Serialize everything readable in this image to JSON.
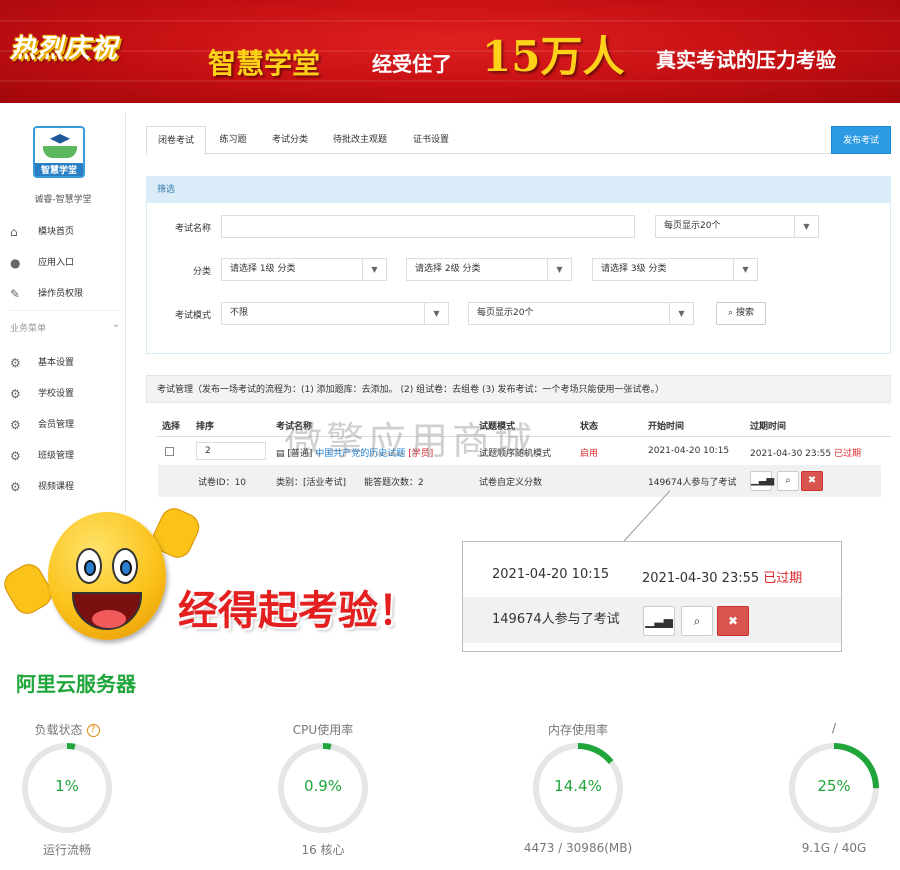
{
  "banner": {
    "celebrate": "热烈庆祝",
    "brand": "智慧学堂",
    "middle": "经受住了",
    "number": "15万人",
    "tail": "真实考试的压力考验"
  },
  "sidebar": {
    "logo_text": "智慧学堂",
    "site_name": "诚睿-智慧学堂",
    "items": [
      {
        "label": "模块首页",
        "icon": "home-icon"
      },
      {
        "label": "应用入口",
        "icon": "chat-icon"
      },
      {
        "label": "操作员权限",
        "icon": "edit-icon"
      }
    ],
    "section": "业务菜单",
    "biz_items": [
      {
        "label": "基本设置",
        "icon": "gear-icon"
      },
      {
        "label": "学校设置",
        "icon": "gear-icon"
      },
      {
        "label": "会员管理",
        "icon": "gear-icon"
      },
      {
        "label": "班级管理",
        "icon": "gear-icon"
      },
      {
        "label": "视频课程",
        "icon": "gear-icon"
      }
    ]
  },
  "tabs": [
    "闭卷考试",
    "练习题",
    "考试分类",
    "待批改主观题",
    "证书设置"
  ],
  "publish_button": "发布考试",
  "filter": {
    "header": "筛选",
    "name_label": "考试名称",
    "per_page_1": "每页显示20个",
    "category_label": "分类",
    "cat1": "请选择 1级 分类",
    "cat2": "请选择 2级 分类",
    "cat3": "请选择 3级 分类",
    "mode_label": "考试模式",
    "mode_value": "不限",
    "per_page_2": "每页显示20个",
    "search_button": "搜索"
  },
  "exam": {
    "header": "考试管理（发布一场考试的流程为：(1) 添加题库：去添加。 (2) 组试卷：去组卷 (3) 发布考试：一个考场只能使用一张试卷。）",
    "columns": [
      "选择",
      "排序",
      "考试名称",
      "试题模式",
      "状态",
      "开始时间",
      "过期时间"
    ],
    "row": {
      "sort": "2",
      "type_tag": "[普通]",
      "name": "中国共产党的历史试题",
      "name_tag": "[学员]",
      "mode": "试题顺序随机模式",
      "status": "启用",
      "start": "2021-04-20 10:15",
      "end": "2021-04-30 23:55",
      "expired": "已过期",
      "paper_id": "试卷ID：10",
      "category": "类别：[活业考试]",
      "answers": "能答题次数：2",
      "scoring": "试卷自定义分数",
      "participants": "149674人参与了考试"
    }
  },
  "watermark": "微擎应用商城",
  "tagline": "经得起考验！",
  "zoom": {
    "start": "2021-04-20 10:15",
    "end": "2021-04-30 23:55",
    "expired": "已过期",
    "participants": "149674人参与了考试"
  },
  "server": {
    "title": "阿里云服务器",
    "accent": "#1fa53a",
    "gauges": [
      {
        "title": "负载状态",
        "value": "1%",
        "bottom": "运行流畅",
        "fraction": 0.01,
        "help": "?"
      },
      {
        "title": "CPU使用率",
        "value": "0.9%",
        "bottom": "16 核心",
        "fraction": 0.009
      },
      {
        "title": "内存使用率",
        "value": "14.4%",
        "bottom": "4473 / 30986(MB)",
        "fraction": 0.144
      },
      {
        "title": "/",
        "value": "25%",
        "bottom": "9.1G / 40G",
        "fraction": 0.25
      }
    ]
  }
}
